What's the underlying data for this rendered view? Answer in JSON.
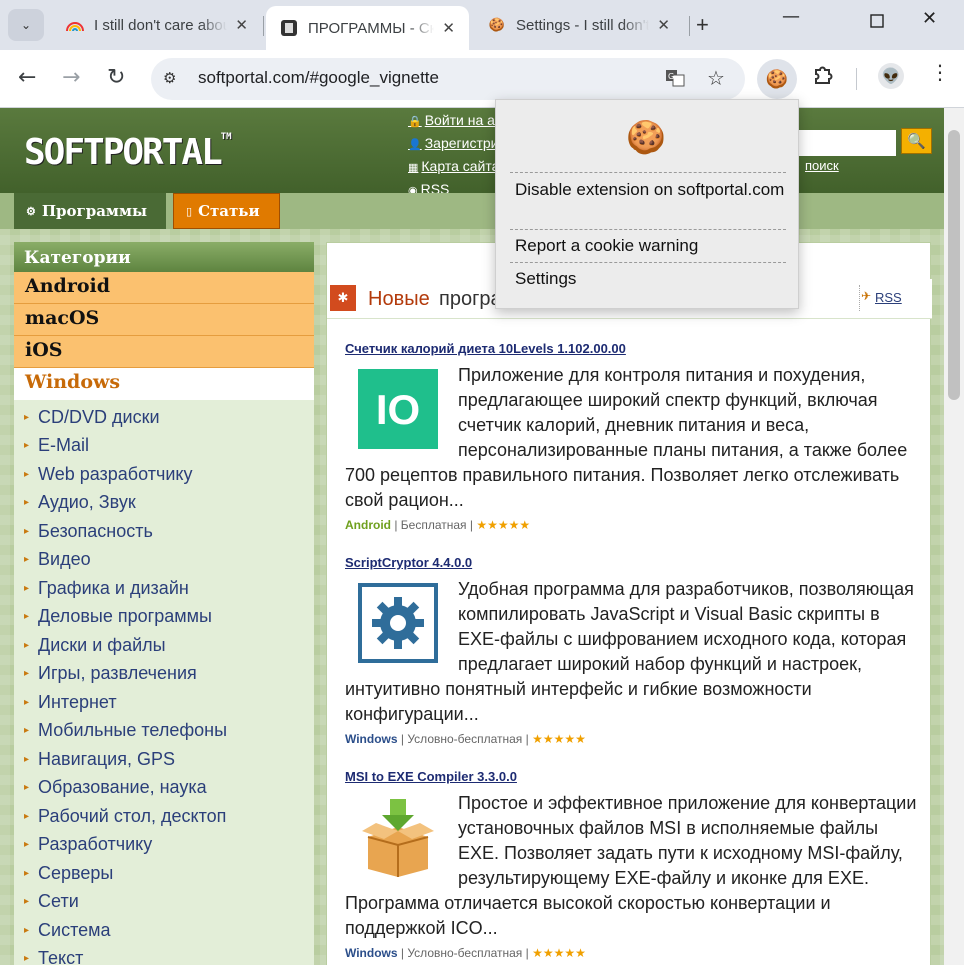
{
  "browser": {
    "tabs": [
      {
        "title": "I still don't care about",
        "favicon": "rainbow-icon",
        "active": false
      },
      {
        "title": "ПРОГРАММЫ - Скачать",
        "favicon": "softportal-icon",
        "active": true
      },
      {
        "title": "Settings - I still don't",
        "favicon": "cookie-icon",
        "active": false
      }
    ],
    "url": "softportal.com/#google_vignette"
  },
  "extension_popup": {
    "icon": "cookie-icon",
    "items": [
      "Disable extension on softportal.com",
      "Report a cookie warning",
      "Settings"
    ]
  },
  "site": {
    "logo": "SOFTPORTAL",
    "logo_tm": "TM",
    "header_links": [
      "Войти на ак",
      "Зарегистри",
      "Карта сайта",
      "RSS"
    ],
    "advanced_search": "поиск",
    "main_tabs": [
      "Программы",
      "Статьи"
    ],
    "categories_title": "Категории",
    "os_categories": [
      "Android",
      "macOS",
      "iOS"
    ],
    "current_os": "Windows",
    "categories": [
      "CD/DVD диски",
      "E-Mail",
      "Web разработчику",
      "Аудио, Звук",
      "Безопасность",
      "Видео",
      "Графика и дизайн",
      "Деловые программы",
      "Диски и файлы",
      "Игры, развлечения",
      "Интернет",
      "Мобильные телефоны",
      "Навигация, GPS",
      "Образование, наука",
      "Рабочий стол, десктоп",
      "Разработчику",
      "Серверы",
      "Сети",
      "Система",
      "Текст"
    ],
    "new_programs_title_1": "Новые",
    "new_programs_title_2": "програм",
    "rss": "RSS",
    "entries": [
      {
        "title": "Счетчик калорий диета 10Levels 1.102.00.00",
        "description": "Приложение для контроля питания и похудения, предлагающее широкий спектр функций, включая счетчик калорий, дневник питания и веса, персонализированные планы питания, а также более 700 рецептов правильного питания. Позволяет легко отслеживать свой рацион...",
        "os": "Android",
        "license": "Бесплатная",
        "stars": "★★★★★",
        "thumb_text": "IO"
      },
      {
        "title": "ScriptCryptor 4.4.0.0",
        "description": "Удобная программа для разработчиков, позволяющая компилировать JavaScript и Visual Basic скрипты в EXE-файлы с шифрованием исходного кода, которая предлагает широкий набор функций и настроек, интуитивно понятный интерфейс и гибкие возможности конфигурации...",
        "os": "Windows",
        "license": "Условно-бесплатная",
        "stars": "★★★★★"
      },
      {
        "title": "MSI to EXE Compiler 3.3.0.0",
        "description": "Простое и эффективное приложение для конвертации установочных файлов MSI в исполняемые файлы EXE. Позволяет задать пути к исходному MSI-файлу, результирующему EXE-файлу и иконке для EXE. Программа отличается высокой скоростью конвертации и поддержкой ICO...",
        "os": "Windows",
        "license": "Условно-бесплатная",
        "stars": "★★★★★"
      }
    ]
  }
}
